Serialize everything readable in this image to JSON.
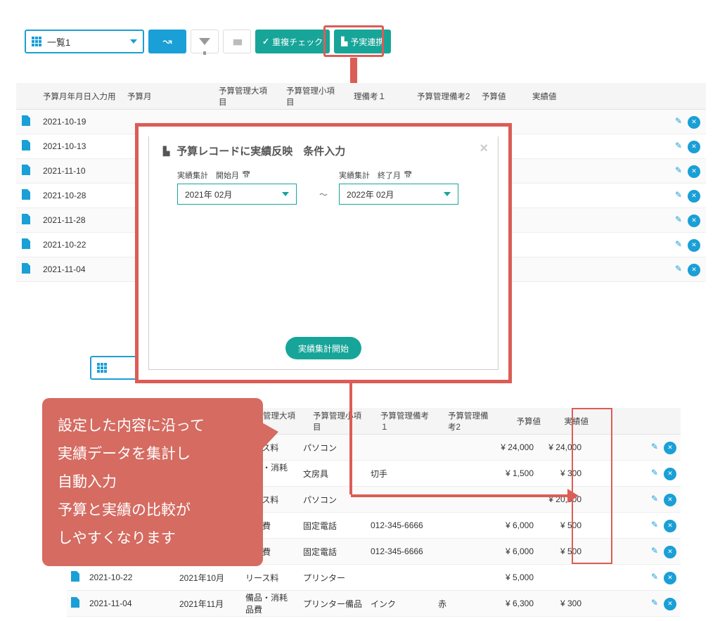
{
  "toolbar": {
    "view_label": "一覧1",
    "dup_check": "重複チェック",
    "budget_link": "予実連携"
  },
  "headers": {
    "date_input": "予算月年月日入力用",
    "month": "予算月",
    "major": "予算管理大項目",
    "minor": "予算管理小項目",
    "note1": "予算管理備考１",
    "note1_short": "理備考１",
    "note2": "予算管理備考2",
    "budget": "予算値",
    "actual": "実績値"
  },
  "table1_rows": [
    {
      "date": "2021-10-19"
    },
    {
      "date": "2021-10-13"
    },
    {
      "date": "2021-11-10"
    },
    {
      "date": "2021-10-28"
    },
    {
      "date": "2021-11-28"
    },
    {
      "date": "2021-10-22"
    },
    {
      "date": "2021-11-04"
    }
  ],
  "modal": {
    "title": "予算レコードに実績反映　条件入力",
    "start_label": "実績集計　開始月",
    "end_label": "実績集計　終了月",
    "start_value": "2021年 02月",
    "end_value": "2022年 02月",
    "tilde": "〜",
    "run": "実績集計開始"
  },
  "table2_rows": [
    {
      "date": "",
      "month": "",
      "major": "リース料",
      "minor": "パソコン",
      "note1": "",
      "note2": "",
      "budget": "¥ 24,000",
      "actual": "¥ 24,000"
    },
    {
      "date": "",
      "month": "",
      "major": "備品・消耗品費",
      "minor": "文房具",
      "note1": "切手",
      "note2": "",
      "budget": "¥ 1,500",
      "actual": "¥ 300"
    },
    {
      "date": "",
      "month": "",
      "major": "リース料",
      "minor": "パソコン",
      "note1": "",
      "note2": "",
      "budget": "",
      "actual": "¥ 20,000"
    },
    {
      "date": "",
      "month": "",
      "major": "通信費",
      "minor": "固定電話",
      "note1": "012-345-6666",
      "note2": "",
      "budget": "¥ 6,000",
      "actual": "¥ 500"
    },
    {
      "date": "",
      "month": "",
      "major": "通信費",
      "minor": "固定電話",
      "note1": "012-345-6666",
      "note2": "",
      "budget": "¥ 6,000",
      "actual": "¥ 500"
    },
    {
      "date": "",
      "month": "",
      "major": "リース料",
      "minor": "プリンター",
      "note1": "",
      "note2": "",
      "budget": "¥ 5,000",
      "actual": ""
    },
    {
      "date": "2021-11-04",
      "month": "2021年11月",
      "major": "備品・消耗品費",
      "minor": "プリンター備品",
      "note1": "インク",
      "note2": "赤",
      "budget": "¥ 6,300",
      "actual": "¥ 300"
    }
  ],
  "table2_extra_date": "2021-10-22",
  "table2_extra_month": "2021年10月",
  "callout": "設定した内容に沿って\n実績データを集計し\n自動入力\n予算と実績の比較が\nしやすくなります"
}
